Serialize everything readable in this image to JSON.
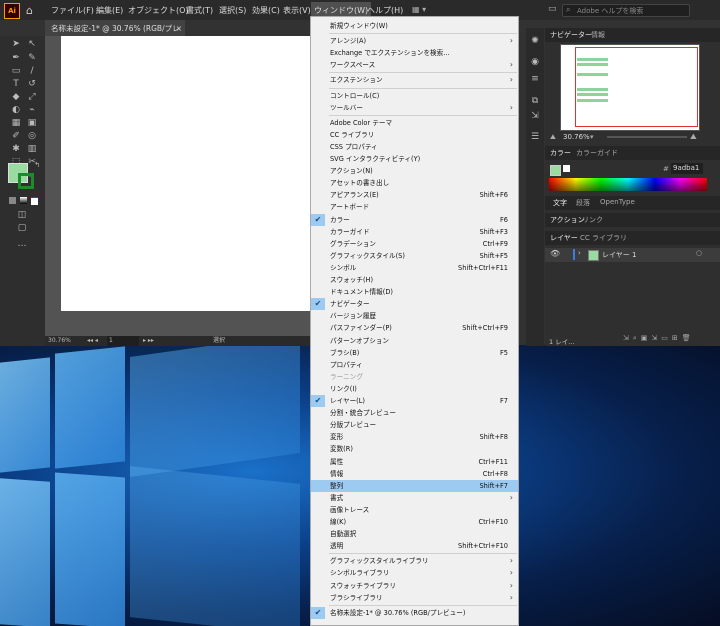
{
  "menubar": {
    "logo": "Ai",
    "items": [
      "ファイル(F)",
      "編集(E)",
      "オブジェクト(O)",
      "書式(T)",
      "選択(S)",
      "効果(C)",
      "表示(V)",
      "ウィンドウ(W)",
      "ヘルプ(H)"
    ],
    "search_placeholder": "Adobe ヘルプを検索"
  },
  "document_tab": {
    "title": "名称未設定-1* @ 30.76% (RGB/プレビュー)",
    "close": "×"
  },
  "statusbar": {
    "zoom": "30.76%",
    "page": "1",
    "mode": "選択"
  },
  "panels": {
    "navigator": {
      "tabs": [
        "ナビゲーター",
        "情報"
      ],
      "zoom": "30.76%"
    },
    "color": {
      "tabs": [
        "カラー",
        "カラーガイド"
      ],
      "hex_label": "#",
      "hex": "9adba1"
    },
    "text": {
      "tabs": [
        "文字",
        "段落",
        "OpenType"
      ]
    },
    "actions": {
      "tabs": [
        "アクション",
        "リンク"
      ]
    },
    "layers": {
      "tabs": [
        "レイヤー",
        "CC ライブラリ"
      ],
      "layer_name": "レイヤー 1",
      "footer": "1 レイ..."
    }
  },
  "colors": {
    "accent": "#9adba1",
    "menu_highlight": "#9ccaf0",
    "artboard_frame": "#e03030"
  },
  "window_menu": [
    {
      "label": "新規ウィンドウ(W)"
    },
    {
      "sep": true
    },
    {
      "label": "アレンジ(A)",
      "sub": true
    },
    {
      "label": "Exchange でエクステンションを検索..."
    },
    {
      "label": "ワークスペース",
      "sub": true
    },
    {
      "sep": true
    },
    {
      "label": "エクステンション",
      "sub": true
    },
    {
      "sep": true
    },
    {
      "label": "コントロール(C)"
    },
    {
      "label": "ツールバー",
      "sub": true
    },
    {
      "sep": true
    },
    {
      "label": "Adobe Color テーマ"
    },
    {
      "label": "CC ライブラリ"
    },
    {
      "label": "CSS プロパティ"
    },
    {
      "label": "SVG インタラクティビティ(Y)"
    },
    {
      "label": "アクション(N)"
    },
    {
      "label": "アセットの書き出し"
    },
    {
      "label": "アピアランス(E)",
      "shortcut": "Shift+F6"
    },
    {
      "label": "アートボード"
    },
    {
      "label": "カラー",
      "shortcut": "F6",
      "checked": true
    },
    {
      "label": "カラーガイド",
      "shortcut": "Shift+F3"
    },
    {
      "label": "グラデーション",
      "shortcut": "Ctrl+F9"
    },
    {
      "label": "グラフィックスタイル(S)",
      "shortcut": "Shift+F5"
    },
    {
      "label": "シンボル",
      "shortcut": "Shift+Ctrl+F11"
    },
    {
      "label": "スウォッチ(H)"
    },
    {
      "label": "ドキュメント情報(D)"
    },
    {
      "label": "ナビゲーター",
      "checked": true
    },
    {
      "label": "バージョン履歴"
    },
    {
      "label": "パスファインダー(P)",
      "shortcut": "Shift+Ctrl+F9"
    },
    {
      "label": "パターンオプション"
    },
    {
      "label": "ブラシ(B)",
      "shortcut": "F5"
    },
    {
      "label": "プロパティ"
    },
    {
      "label": "ラーニング",
      "disabled": true
    },
    {
      "label": "リンク(I)"
    },
    {
      "label": "レイヤー(L)",
      "shortcut": "F7",
      "checked": true
    },
    {
      "label": "分割・統合プレビュー"
    },
    {
      "label": "分版プレビュー"
    },
    {
      "label": "変形",
      "shortcut": "Shift+F8"
    },
    {
      "label": "変数(R)"
    },
    {
      "label": "属性",
      "shortcut": "Ctrl+F11"
    },
    {
      "label": "情報",
      "shortcut": "Ctrl+F8"
    },
    {
      "label": "整列",
      "shortcut": "Shift+F7",
      "highlighted": true
    },
    {
      "label": "書式",
      "sub": true
    },
    {
      "label": "画像トレース"
    },
    {
      "label": "線(K)",
      "shortcut": "Ctrl+F10"
    },
    {
      "label": "自動選択"
    },
    {
      "label": "透明",
      "shortcut": "Shift+Ctrl+F10"
    },
    {
      "sep": true
    },
    {
      "label": "グラフィックスタイルライブラリ",
      "sub": true
    },
    {
      "label": "シンボルライブラリ",
      "sub": true
    },
    {
      "label": "スウォッチライブラリ",
      "sub": true
    },
    {
      "label": "ブラシライブラリ",
      "sub": true
    },
    {
      "sep": true
    },
    {
      "label": "名称未設定-1* @ 30.76% (RGB/プレビュー)",
      "checked": true
    }
  ]
}
